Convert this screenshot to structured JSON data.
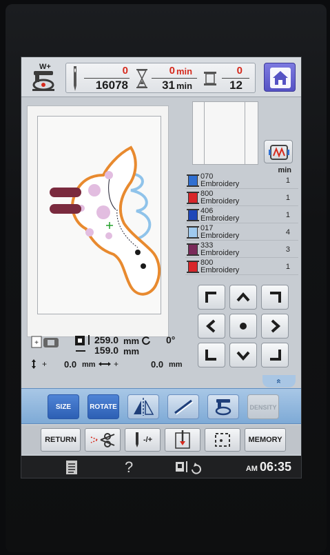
{
  "header": {
    "needle_count_top": "0",
    "needle_count_bottom": "16078",
    "time_top_value": "0",
    "time_top_unit": "min",
    "time_bottom_value": "31",
    "time_bottom_unit": "min",
    "color_top": "0",
    "color_bottom": "12",
    "presser_label": "W+",
    "home_icon": "home-icon"
  },
  "colors": {
    "min_header": "min",
    "rows": [
      {
        "code": "070",
        "name": "Embroidery",
        "min": "1",
        "color": "#2f6fd1"
      },
      {
        "code": "800",
        "name": "Embroidery",
        "min": "1",
        "color": "#d8262a"
      },
      {
        "code": "406",
        "name": "Embroidery",
        "min": "1",
        "color": "#1f47b8"
      },
      {
        "code": "017",
        "name": "Embroidery",
        "min": "4",
        "color": "#9fc9ee"
      },
      {
        "code": "333",
        "name": "Embroidery",
        "min": "3",
        "color": "#7a2a5a"
      },
      {
        "code": "800",
        "name": "Embroidery",
        "min": "1",
        "color": "#d8262a"
      }
    ]
  },
  "info": {
    "height_value": "259.0",
    "height_unit": "mm",
    "width_value": "159.0",
    "width_unit": "mm",
    "angle": "0°",
    "offset_y_value": "0.0",
    "offset_y_unit": "mm",
    "offset_x_value": "0.0",
    "offset_x_unit": "mm"
  },
  "toolbar": {
    "size": "SIZE",
    "rotate": "ROTATE",
    "density": "DENSITY"
  },
  "bottom": {
    "return": "RETURN",
    "needle_label": "-/+",
    "memory": "MEMORY"
  },
  "status": {
    "help": "?",
    "ampm": "AM",
    "time": "06:35"
  },
  "expand": "«"
}
